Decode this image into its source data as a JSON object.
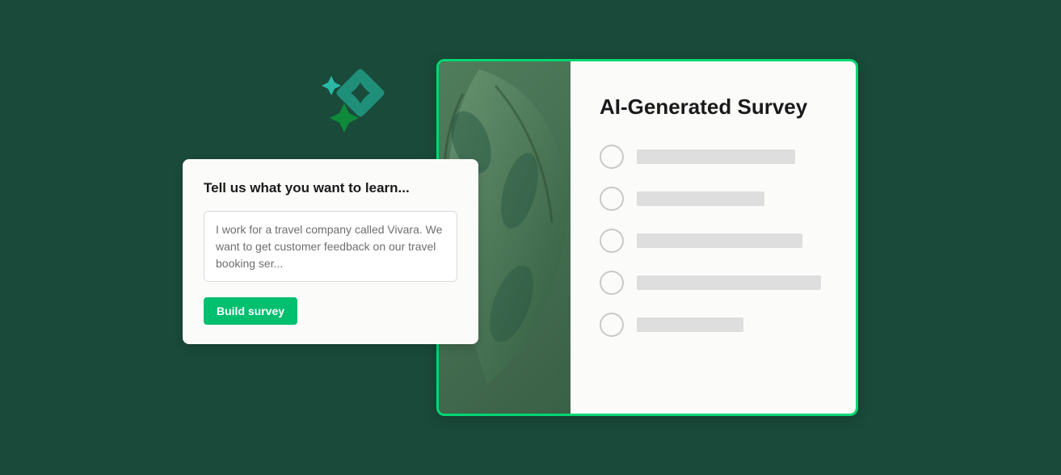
{
  "inputCard": {
    "heading": "Tell us what you want to learn...",
    "textareaValue": "I work for a travel company called Vivara. We want to get customer feedback on our travel booking ser...",
    "buttonLabel": "Build survey"
  },
  "surveyCard": {
    "title": "AI-Generated Survey",
    "optionBarWidths": [
      196,
      158,
      205,
      228,
      132
    ]
  },
  "colors": {
    "background": "#1a4a3a",
    "accent": "#00bf6f",
    "border": "#00d672",
    "sparkleTeal": "#2ab8a5",
    "sparkleGreen": "#0e8a3a"
  }
}
